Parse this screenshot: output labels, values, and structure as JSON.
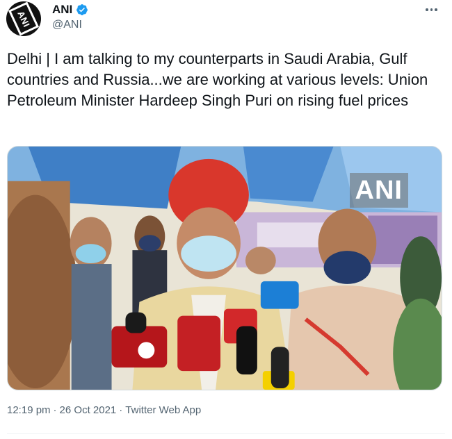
{
  "author": {
    "display_name": "ANI",
    "handle": "@ANI",
    "avatar_text": "ANI",
    "verified": true
  },
  "tweet": {
    "text": "Delhi | I am talking to my counterparts in Saudi Arabia, Gulf countries and Russia...we are working at various levels: Union Petroleum Minister Hardeep Singh Puri on rising fuel prices",
    "media_watermark": "ANI"
  },
  "meta": {
    "time": "12:19 pm",
    "separator": "·",
    "date": "26 Oct 2021",
    "source": "Twitter Web App"
  },
  "icons": {
    "verified": "verified-badge-icon",
    "more": "more-options-icon"
  },
  "colors": {
    "verified_blue": "#1d9bf0",
    "text_primary": "#0f1419",
    "text_secondary": "#536471"
  }
}
